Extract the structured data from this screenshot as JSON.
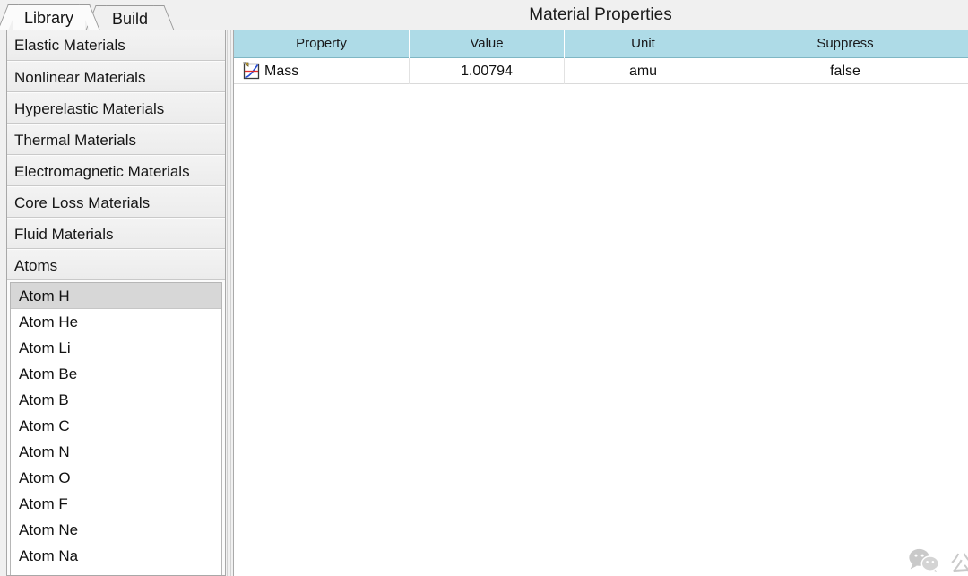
{
  "header": {
    "title": "Material Properties"
  },
  "tabs": [
    {
      "label": "Library",
      "active": true
    },
    {
      "label": "Build",
      "active": false
    }
  ],
  "sidebar": {
    "categories": [
      {
        "label": "Elastic Materials"
      },
      {
        "label": "Nonlinear Materials"
      },
      {
        "label": "Hyperelastic Materials"
      },
      {
        "label": "Thermal Materials"
      },
      {
        "label": "Electromagnetic Materials"
      },
      {
        "label": "Core Loss Materials"
      },
      {
        "label": "Fluid Materials"
      },
      {
        "label": "Atoms"
      }
    ],
    "atoms": [
      {
        "label": "Atom H",
        "selected": true
      },
      {
        "label": "Atom He",
        "selected": false
      },
      {
        "label": "Atom Li",
        "selected": false
      },
      {
        "label": "Atom Be",
        "selected": false
      },
      {
        "label": "Atom B",
        "selected": false
      },
      {
        "label": "Atom C",
        "selected": false
      },
      {
        "label": "Atom N",
        "selected": false
      },
      {
        "label": "Atom O",
        "selected": false
      },
      {
        "label": "Atom F",
        "selected": false
      },
      {
        "label": "Atom Ne",
        "selected": false
      },
      {
        "label": "Atom Na",
        "selected": false
      }
    ]
  },
  "table": {
    "columns": [
      "Property",
      "Value",
      "Unit",
      "Suppress"
    ],
    "rows": [
      {
        "icon": "curve-chart-icon",
        "property": "Mass",
        "value": "1.00794",
        "unit": "amu",
        "suppress": "false"
      }
    ]
  },
  "watermark": {
    "icon": "wechat-icon",
    "text": "公众号 · WELSIM"
  },
  "colors": {
    "table_header_bg": "#aedbe7",
    "selection_bg": "#d7d7d7",
    "window_bg": "#f0f0f0",
    "category_bg": "#ececec",
    "watermark_text": "#c9c9c9"
  }
}
